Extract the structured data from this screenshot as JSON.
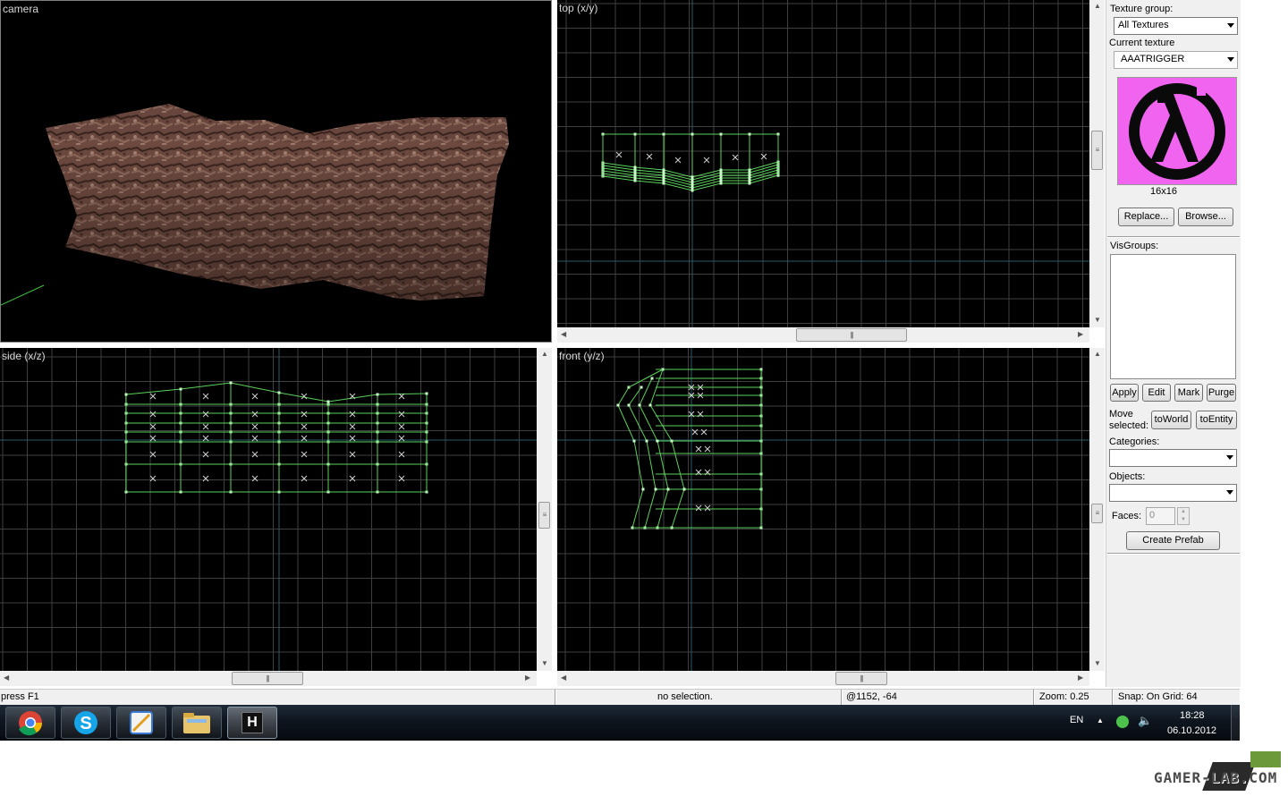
{
  "viewports": {
    "camera": {
      "label": "camera"
    },
    "top": {
      "label": "top (x/y)"
    },
    "side": {
      "label": "side (x/z)"
    },
    "front": {
      "label": "front (y/z)"
    }
  },
  "right_panel": {
    "texture_group_label": "Texture group:",
    "texture_group_value": "All Textures",
    "current_texture_label": "Current texture",
    "current_texture_value": "AAATRIGGER",
    "texture_size": "16x16",
    "replace_button": "Replace...",
    "browse_button": "Browse...",
    "visgroups_label": "VisGroups:",
    "apply_button": "Apply",
    "edit_button": "Edit",
    "mark_button": "Mark",
    "purge_button": "Purge",
    "move_selected_label_1": "Move",
    "move_selected_label_2": "selected:",
    "toworld_button": "toWorld",
    "toentity_button": "toEntity",
    "categories_label": "Categories:",
    "categories_value": "",
    "objects_label": "Objects:",
    "objects_value": "",
    "faces_label": "Faces:",
    "faces_value": "0",
    "create_prefab_button": "Create Prefab"
  },
  "status_bar": {
    "help": "press F1",
    "selection": "no selection.",
    "coords": "@1152, -64",
    "zoom": "Zoom: 0.25",
    "snap": "Snap: On Grid: 64"
  },
  "taskbar": {
    "apps": [
      "chrome-icon",
      "skype-icon",
      "editor-icon",
      "folder-icon",
      "hammer-icon"
    ],
    "hammer_glyph": "H",
    "language": "EN",
    "time": "18:28",
    "date": "06.10.2012"
  },
  "watermark": "GAMER-LAB.COM",
  "colors": {
    "grid": "#404040",
    "grid_axis": "#2a5a6a",
    "brush": "#5ad25a",
    "vertex": "#c8ffc8",
    "texture_pink": "#f064f0",
    "taskbar": "#0e151e"
  }
}
